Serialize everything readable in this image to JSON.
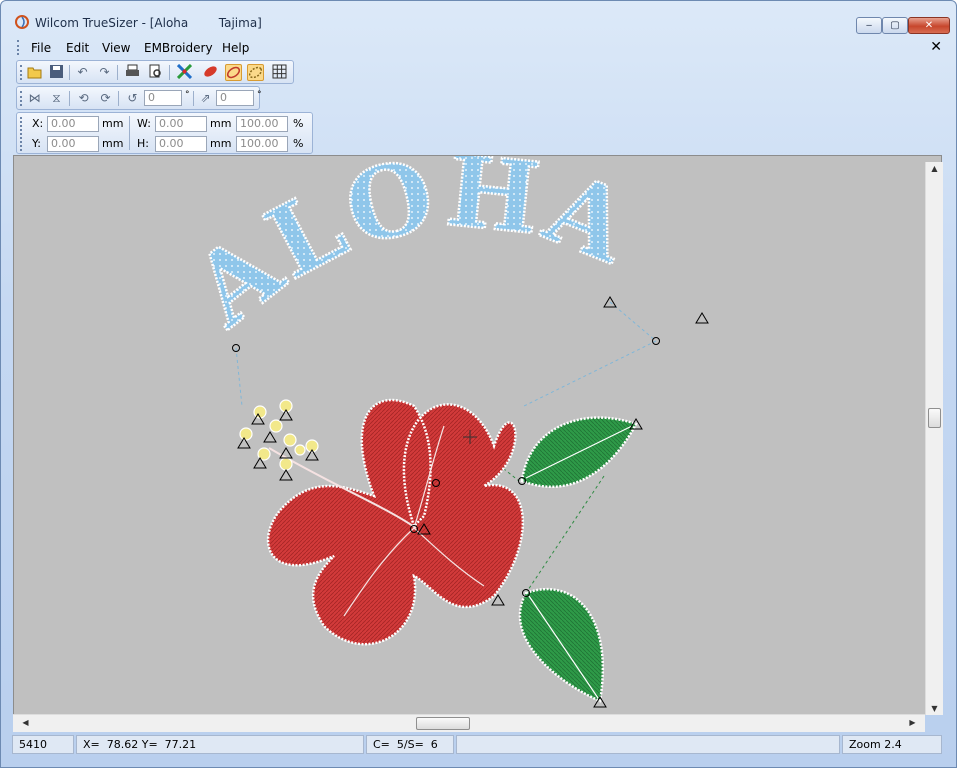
{
  "window": {
    "title": "Wilcom TrueSizer - [Aloha        Tajima]",
    "controls": {
      "minimize": "‒",
      "maximize": "▢",
      "close": "✕"
    }
  },
  "menu": {
    "items": [
      "File",
      "Edit",
      "View",
      "EMBroidery",
      "Help"
    ],
    "mdi_close": "✕"
  },
  "toolbar2": {
    "rotate_value": "0",
    "rotate_unit": "°",
    "slant_value": "0",
    "slant_unit": "°"
  },
  "position": {
    "x_label": "X:",
    "x_value": "0.00",
    "x_unit": "mm",
    "y_label": "Y:",
    "y_value": "0.00",
    "y_unit": "mm",
    "w_label": "W:",
    "w_value": "0.00",
    "w_unit": "mm",
    "w_percent": "100.00",
    "w_percent_unit": "%",
    "h_label": "H:",
    "h_value": "0.00",
    "h_unit": "mm",
    "h_percent": "100.00",
    "h_percent_unit": "%"
  },
  "design": {
    "text": "ALOHA !",
    "colors": {
      "text": "#8fc6ea",
      "flower": "#d23a3a",
      "leaves": "#2e9a48",
      "stamen": "#f2e88a",
      "background": "#c0c0c0"
    }
  },
  "status": {
    "stitches": "5410",
    "coordinates": "X=  78.62 Y=  77.21",
    "color_stops": "C=  5/S=  6",
    "zoom": "Zoom 2.4"
  }
}
